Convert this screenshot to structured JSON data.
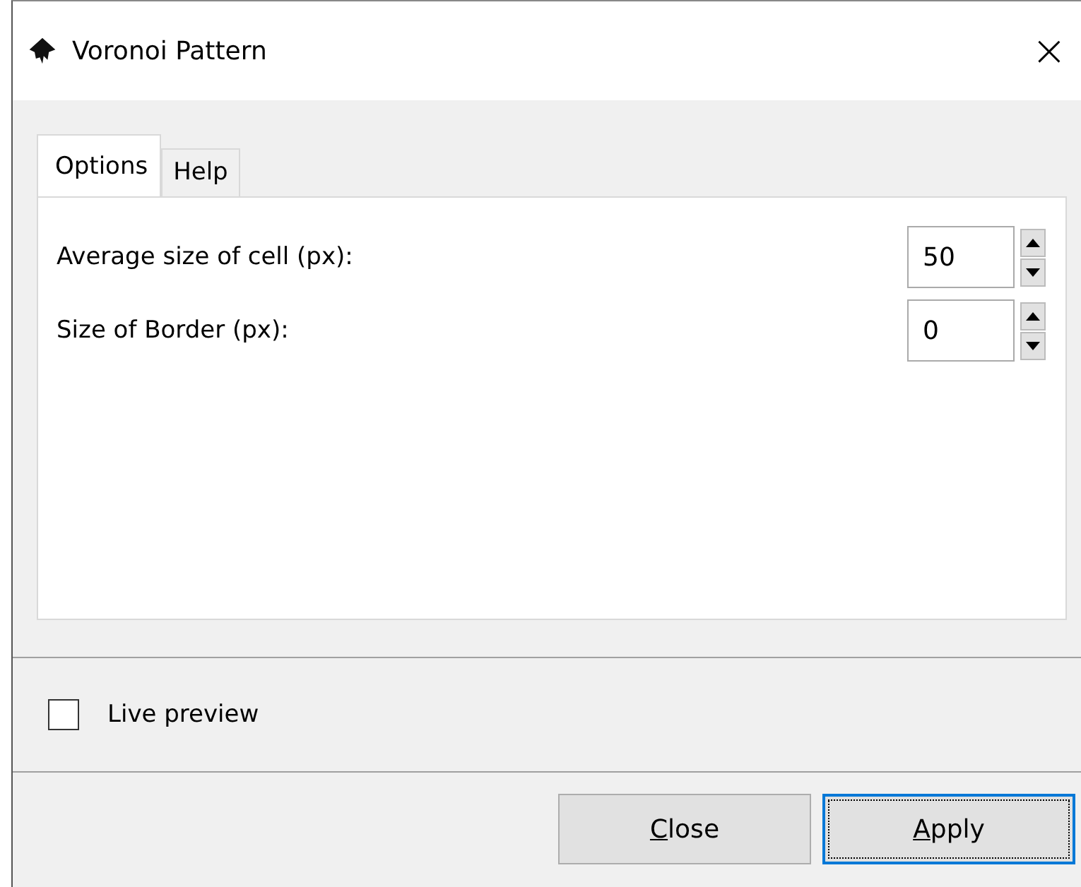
{
  "window": {
    "title": "Voronoi Pattern",
    "close": "×"
  },
  "tabs": [
    {
      "label": "Options",
      "selected": true
    },
    {
      "label": "Help",
      "selected": false
    }
  ],
  "fields": [
    {
      "label": "Average size of cell (px):",
      "value": "50"
    },
    {
      "label": "Size of Border (px):",
      "value": "0"
    }
  ],
  "live_preview": {
    "label": "Live preview",
    "checked": false
  },
  "buttons": [
    {
      "label": "Close",
      "focused": false,
      "underline_first": true
    },
    {
      "label": "Apply",
      "focused": true,
      "underline_first": true
    }
  ]
}
